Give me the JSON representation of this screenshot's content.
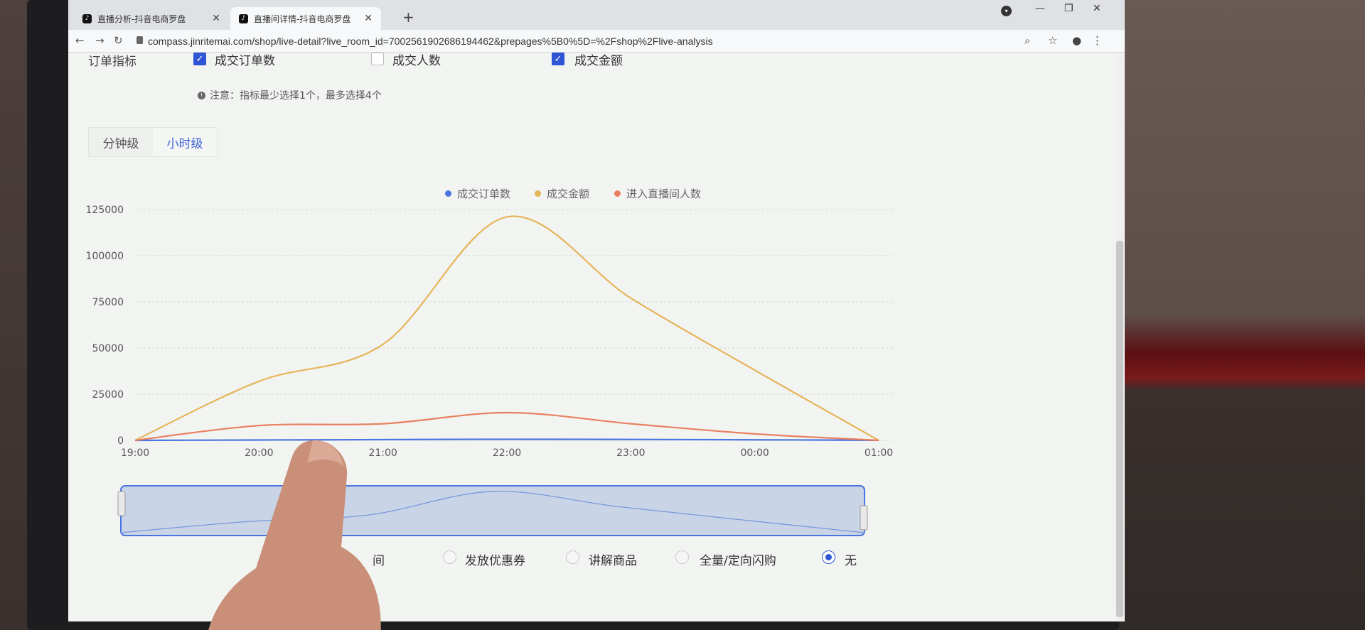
{
  "browser": {
    "tabs": [
      {
        "title": "直播分析-抖音电商罗盘"
      },
      {
        "title": "直播间详情-抖音电商罗盘"
      }
    ],
    "new_tab": "+",
    "url": "compass.jinritemai.com/shop/live-detail?live_room_id=7002561902686194462&prepages%5B0%5D=%2Fshop%2Flive-analysis"
  },
  "metrics": {
    "label": "订单指标",
    "options": [
      {
        "label": "成交订单数",
        "checked": true
      },
      {
        "label": "成交人数",
        "checked": false
      },
      {
        "label": "成交金额",
        "checked": true
      }
    ],
    "note": "注意：指标最少选择1个，最多选择4个"
  },
  "granularity": {
    "options": [
      "分钟级",
      "小时级"
    ],
    "selected": "小时级"
  },
  "chart_data": {
    "type": "line",
    "x": [
      "19:00",
      "20:00",
      "21:00",
      "22:00",
      "23:00",
      "00:00",
      "01:00"
    ],
    "series": [
      {
        "name": "成交订单数",
        "color": "#4a74e0",
        "values": [
          0,
          200,
          400,
          600,
          500,
          300,
          50
        ]
      },
      {
        "name": "成交金额",
        "color": "#e6b55a",
        "values": [
          0,
          32000,
          52000,
          121000,
          77000,
          38000,
          0
        ]
      },
      {
        "name": "进入直播间人数",
        "color": "#e88060",
        "values": [
          0,
          8000,
          9000,
          15000,
          9000,
          3500,
          0
        ]
      }
    ],
    "yticks": [
      "125000",
      "100000",
      "75000",
      "50000",
      "25000",
      "0"
    ],
    "ylim": [
      0,
      125000
    ],
    "grid": true,
    "legend": "top-center"
  },
  "events": {
    "label_fragment": "间",
    "options": [
      {
        "label": "发放优惠券",
        "selected": false
      },
      {
        "label": "讲解商品",
        "selected": false
      },
      {
        "label": "全量/定向闪购",
        "selected": false
      },
      {
        "label": "无",
        "selected": true
      }
    ]
  }
}
